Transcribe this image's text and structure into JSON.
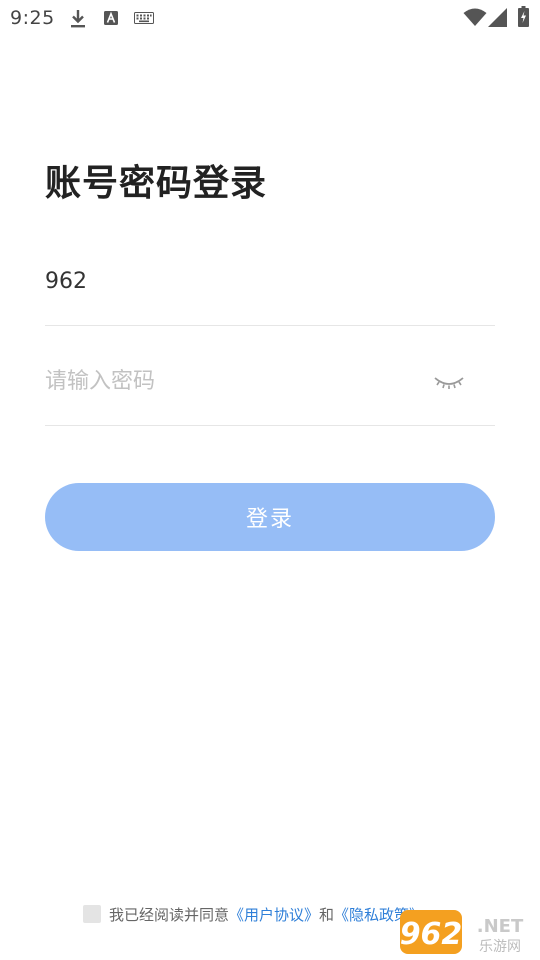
{
  "status_bar": {
    "time": "9:25",
    "icons": [
      "download-icon",
      "font-a-icon",
      "keyboard-icon",
      "wifi-icon",
      "cell-signal-icon",
      "battery-charging-icon"
    ]
  },
  "login": {
    "title": "账号密码登录",
    "account_value": "962",
    "password_placeholder": "请输入密码",
    "password_toggle_icon": "eye-closed-icon",
    "login_button": "登录",
    "button_color": "#96bdf6"
  },
  "agreement": {
    "prefix": "我已经阅读并同意",
    "user_agreement": "《用户协议》",
    "conjunction": "和",
    "privacy_policy": "《隐私政策》",
    "link_color": "#2f7fd8"
  },
  "watermark": {
    "brand": "962.NET",
    "subtitle": "乐游网"
  }
}
